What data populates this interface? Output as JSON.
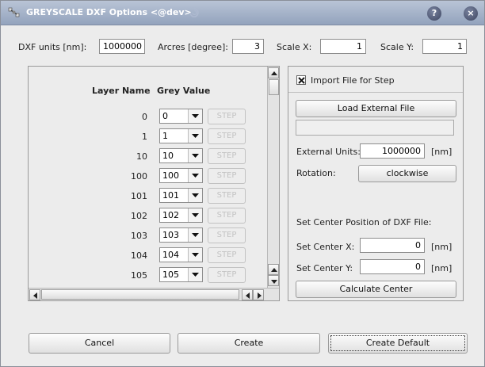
{
  "window": {
    "title": "GREYSCALE DXF Options <@dev>",
    "help_label": "?",
    "close_label": "×"
  },
  "top": {
    "dxf_units_label": "DXF units [nm]:",
    "dxf_units_value": "1000000",
    "arcres_label": "Arcres [degree]:",
    "arcres_value": "3",
    "scale_x_label": "Scale X:",
    "scale_x_value": "1",
    "scale_y_label": "Scale Y:",
    "scale_y_value": "1"
  },
  "layers": {
    "col_layer_name": "Layer Name",
    "col_grey_value": "Grey Value",
    "step_label": "STEP",
    "rows": [
      {
        "name": "0",
        "grey": "0"
      },
      {
        "name": "1",
        "grey": "1"
      },
      {
        "name": "10",
        "grey": "10"
      },
      {
        "name": "100",
        "grey": "100"
      },
      {
        "name": "101",
        "grey": "101"
      },
      {
        "name": "102",
        "grey": "102"
      },
      {
        "name": "103",
        "grey": "103"
      },
      {
        "name": "104",
        "grey": "104"
      },
      {
        "name": "105",
        "grey": "105"
      }
    ]
  },
  "import": {
    "checkbox_label": "Import File for Step",
    "checked": true,
    "load_button": "Load External File",
    "file_path": "",
    "external_units_label": "External Units:",
    "external_units_value": "1000000",
    "external_units_unit": "[nm]",
    "rotation_label": "Rotation:",
    "rotation_value": "clockwise",
    "center_heading": "Set Center Position of DXF File:",
    "center_x_label": "Set Center X:",
    "center_x_value": "0",
    "center_x_unit": "[nm]",
    "center_y_label": "Set Center Y:",
    "center_y_value": "0",
    "center_y_unit": "[nm]",
    "calculate_button": "Calculate Center"
  },
  "footer": {
    "cancel": "Cancel",
    "create": "Create",
    "create_default": "Create Default"
  },
  "colors": {
    "titlebar": "#93a3bd",
    "background": "#ececec",
    "disabled_text": "#c3c3c3"
  },
  "icons": {
    "app": "satellite-icon",
    "help": "help-icon",
    "close": "close-icon"
  }
}
